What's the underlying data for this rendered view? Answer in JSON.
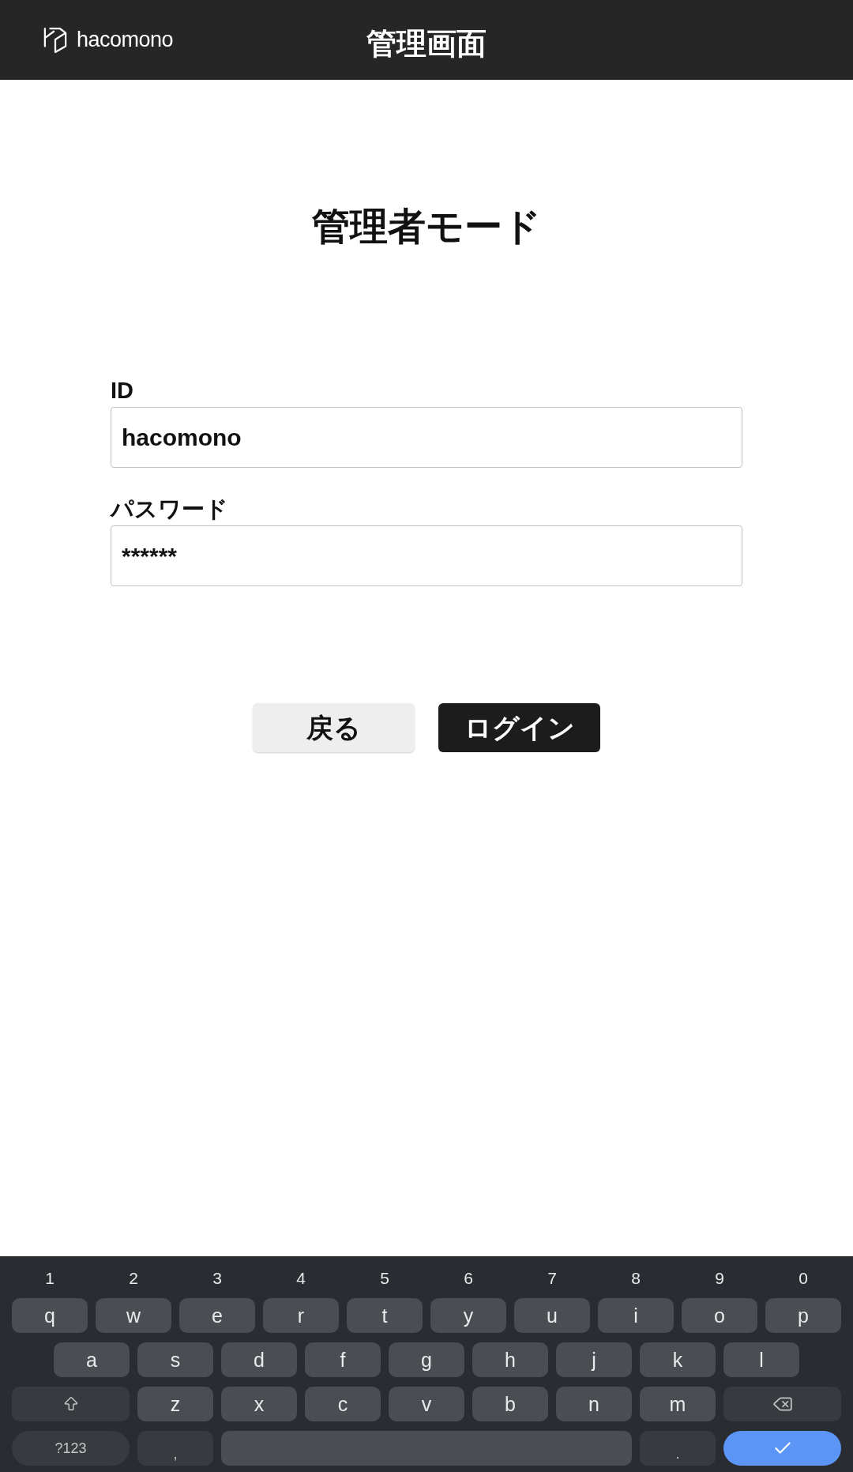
{
  "header": {
    "logo_text": "hacomono",
    "title": "管理画面"
  },
  "heading": "管理者モード",
  "fields": [
    {
      "label": "ID",
      "value": "hacomono"
    },
    {
      "label": "パスワード",
      "value": "******"
    }
  ],
  "buttons": [
    {
      "label": "戻る",
      "kind": "secondary"
    },
    {
      "label": "ログイン",
      "kind": "primary"
    }
  ],
  "keyboard": {
    "number_row": [
      "1",
      "2",
      "3",
      "4",
      "5",
      "6",
      "7",
      "8",
      "9",
      "0"
    ],
    "key_rows": [
      {
        "keys": [
          {
            "kind": "letter",
            "label": "q"
          },
          {
            "kind": "letter",
            "label": "w"
          },
          {
            "kind": "letter",
            "label": "e"
          },
          {
            "kind": "letter",
            "label": "r"
          },
          {
            "kind": "letter",
            "label": "t"
          },
          {
            "kind": "letter",
            "label": "y"
          },
          {
            "kind": "letter",
            "label": "u"
          },
          {
            "kind": "letter",
            "label": "i"
          },
          {
            "kind": "letter",
            "label": "o"
          },
          {
            "kind": "letter",
            "label": "p"
          }
        ]
      },
      {
        "keys": [
          {
            "kind": "letter",
            "label": "a"
          },
          {
            "kind": "letter",
            "label": "s"
          },
          {
            "kind": "letter",
            "label": "d"
          },
          {
            "kind": "letter",
            "label": "f"
          },
          {
            "kind": "letter",
            "label": "g"
          },
          {
            "kind": "letter",
            "label": "h"
          },
          {
            "kind": "letter",
            "label": "j"
          },
          {
            "kind": "letter",
            "label": "k"
          },
          {
            "kind": "letter",
            "label": "l"
          }
        ]
      },
      {
        "keys": [
          {
            "kind": "shift"
          },
          {
            "kind": "letter",
            "label": "z"
          },
          {
            "kind": "letter",
            "label": "x"
          },
          {
            "kind": "letter",
            "label": "c"
          },
          {
            "kind": "letter",
            "label": "v"
          },
          {
            "kind": "letter",
            "label": "b"
          },
          {
            "kind": "letter",
            "label": "n"
          },
          {
            "kind": "letter",
            "label": "m"
          },
          {
            "kind": "backspace"
          }
        ]
      },
      {
        "keys": [
          {
            "kind": "symbols",
            "label": "?123"
          },
          {
            "kind": "punctuation",
            "label": ","
          },
          {
            "kind": "space"
          },
          {
            "kind": "punctuation",
            "label": "."
          },
          {
            "kind": "enter"
          }
        ]
      }
    ]
  }
}
